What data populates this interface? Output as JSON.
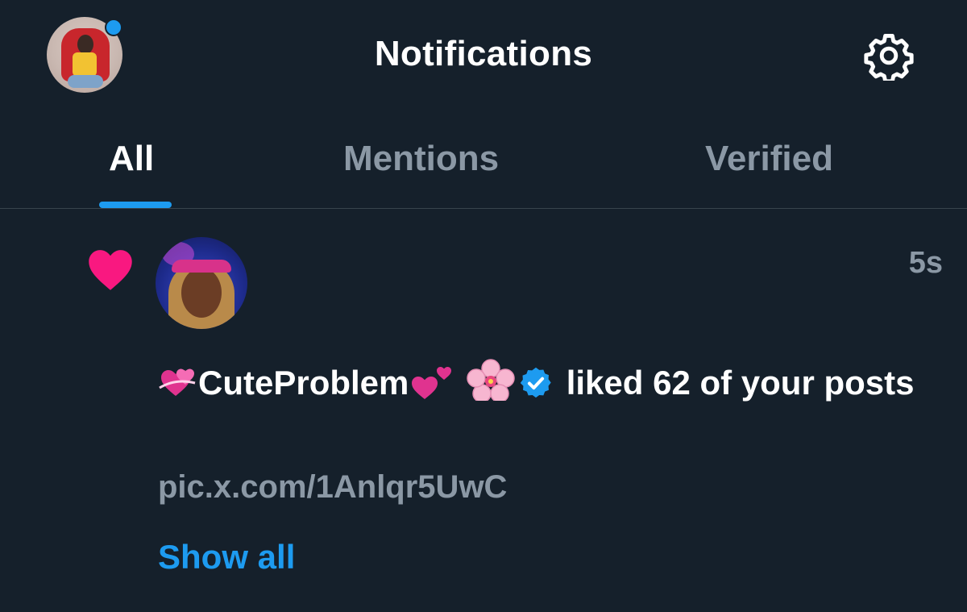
{
  "header": {
    "title": "Notifications",
    "avatar_icon": "user-avatar",
    "settings_icon": "gear-icon",
    "presence_dot_color": "#1d9bf0"
  },
  "tabs": [
    {
      "label": "All",
      "active": true
    },
    {
      "label": "Mentions",
      "active": false
    },
    {
      "label": "Verified",
      "active": false
    }
  ],
  "notification": {
    "type_icon": "heart-icon",
    "type_icon_color": "#f91880",
    "time": "5s",
    "actor_name": "CuteProblem",
    "actor_verified": true,
    "action_text": "liked 62 of your posts",
    "link": "pic.x.com/1Anlqr5UwC",
    "show_all": "Show all"
  },
  "colors": {
    "background": "#15202b",
    "accent": "#1d9bf0",
    "secondary_text": "#8b98a5",
    "divider": "#38444d"
  }
}
